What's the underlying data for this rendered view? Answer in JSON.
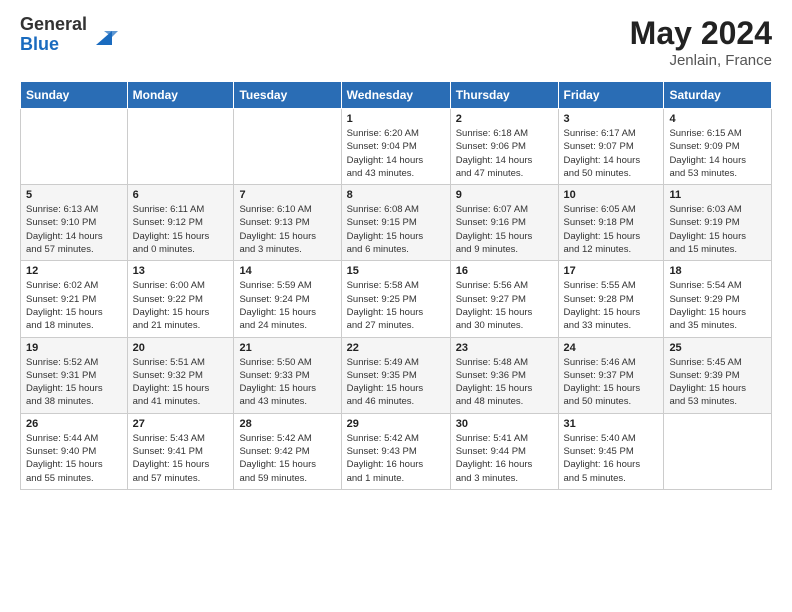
{
  "logo": {
    "general": "General",
    "blue": "Blue"
  },
  "title": {
    "month": "May 2024",
    "location": "Jenlain, France"
  },
  "headers": [
    "Sunday",
    "Monday",
    "Tuesday",
    "Wednesday",
    "Thursday",
    "Friday",
    "Saturday"
  ],
  "weeks": [
    [
      {
        "day": "",
        "info": ""
      },
      {
        "day": "",
        "info": ""
      },
      {
        "day": "",
        "info": ""
      },
      {
        "day": "1",
        "info": "Sunrise: 6:20 AM\nSunset: 9:04 PM\nDaylight: 14 hours\nand 43 minutes."
      },
      {
        "day": "2",
        "info": "Sunrise: 6:18 AM\nSunset: 9:06 PM\nDaylight: 14 hours\nand 47 minutes."
      },
      {
        "day": "3",
        "info": "Sunrise: 6:17 AM\nSunset: 9:07 PM\nDaylight: 14 hours\nand 50 minutes."
      },
      {
        "day": "4",
        "info": "Sunrise: 6:15 AM\nSunset: 9:09 PM\nDaylight: 14 hours\nand 53 minutes."
      }
    ],
    [
      {
        "day": "5",
        "info": "Sunrise: 6:13 AM\nSunset: 9:10 PM\nDaylight: 14 hours\nand 57 minutes."
      },
      {
        "day": "6",
        "info": "Sunrise: 6:11 AM\nSunset: 9:12 PM\nDaylight: 15 hours\nand 0 minutes."
      },
      {
        "day": "7",
        "info": "Sunrise: 6:10 AM\nSunset: 9:13 PM\nDaylight: 15 hours\nand 3 minutes."
      },
      {
        "day": "8",
        "info": "Sunrise: 6:08 AM\nSunset: 9:15 PM\nDaylight: 15 hours\nand 6 minutes."
      },
      {
        "day": "9",
        "info": "Sunrise: 6:07 AM\nSunset: 9:16 PM\nDaylight: 15 hours\nand 9 minutes."
      },
      {
        "day": "10",
        "info": "Sunrise: 6:05 AM\nSunset: 9:18 PM\nDaylight: 15 hours\nand 12 minutes."
      },
      {
        "day": "11",
        "info": "Sunrise: 6:03 AM\nSunset: 9:19 PM\nDaylight: 15 hours\nand 15 minutes."
      }
    ],
    [
      {
        "day": "12",
        "info": "Sunrise: 6:02 AM\nSunset: 9:21 PM\nDaylight: 15 hours\nand 18 minutes."
      },
      {
        "day": "13",
        "info": "Sunrise: 6:00 AM\nSunset: 9:22 PM\nDaylight: 15 hours\nand 21 minutes."
      },
      {
        "day": "14",
        "info": "Sunrise: 5:59 AM\nSunset: 9:24 PM\nDaylight: 15 hours\nand 24 minutes."
      },
      {
        "day": "15",
        "info": "Sunrise: 5:58 AM\nSunset: 9:25 PM\nDaylight: 15 hours\nand 27 minutes."
      },
      {
        "day": "16",
        "info": "Sunrise: 5:56 AM\nSunset: 9:27 PM\nDaylight: 15 hours\nand 30 minutes."
      },
      {
        "day": "17",
        "info": "Sunrise: 5:55 AM\nSunset: 9:28 PM\nDaylight: 15 hours\nand 33 minutes."
      },
      {
        "day": "18",
        "info": "Sunrise: 5:54 AM\nSunset: 9:29 PM\nDaylight: 15 hours\nand 35 minutes."
      }
    ],
    [
      {
        "day": "19",
        "info": "Sunrise: 5:52 AM\nSunset: 9:31 PM\nDaylight: 15 hours\nand 38 minutes."
      },
      {
        "day": "20",
        "info": "Sunrise: 5:51 AM\nSunset: 9:32 PM\nDaylight: 15 hours\nand 41 minutes."
      },
      {
        "day": "21",
        "info": "Sunrise: 5:50 AM\nSunset: 9:33 PM\nDaylight: 15 hours\nand 43 minutes."
      },
      {
        "day": "22",
        "info": "Sunrise: 5:49 AM\nSunset: 9:35 PM\nDaylight: 15 hours\nand 46 minutes."
      },
      {
        "day": "23",
        "info": "Sunrise: 5:48 AM\nSunset: 9:36 PM\nDaylight: 15 hours\nand 48 minutes."
      },
      {
        "day": "24",
        "info": "Sunrise: 5:46 AM\nSunset: 9:37 PM\nDaylight: 15 hours\nand 50 minutes."
      },
      {
        "day": "25",
        "info": "Sunrise: 5:45 AM\nSunset: 9:39 PM\nDaylight: 15 hours\nand 53 minutes."
      }
    ],
    [
      {
        "day": "26",
        "info": "Sunrise: 5:44 AM\nSunset: 9:40 PM\nDaylight: 15 hours\nand 55 minutes."
      },
      {
        "day": "27",
        "info": "Sunrise: 5:43 AM\nSunset: 9:41 PM\nDaylight: 15 hours\nand 57 minutes."
      },
      {
        "day": "28",
        "info": "Sunrise: 5:42 AM\nSunset: 9:42 PM\nDaylight: 15 hours\nand 59 minutes."
      },
      {
        "day": "29",
        "info": "Sunrise: 5:42 AM\nSunset: 9:43 PM\nDaylight: 16 hours\nand 1 minute."
      },
      {
        "day": "30",
        "info": "Sunrise: 5:41 AM\nSunset: 9:44 PM\nDaylight: 16 hours\nand 3 minutes."
      },
      {
        "day": "31",
        "info": "Sunrise: 5:40 AM\nSunset: 9:45 PM\nDaylight: 16 hours\nand 5 minutes."
      },
      {
        "day": "",
        "info": ""
      }
    ]
  ]
}
